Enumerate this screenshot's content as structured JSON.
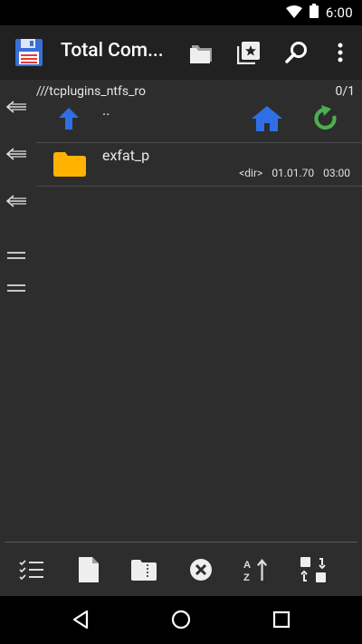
{
  "status": {
    "time": "6:00"
  },
  "app": {
    "title": "Total Com..."
  },
  "panel": {
    "path": "///tcplugins_ntfs_ro",
    "count": "0/1",
    "up_label": "..",
    "files": [
      {
        "name": "exfat_p",
        "type": "<dir>",
        "date": "01.01.70",
        "time": "03:00"
      }
    ]
  },
  "colors": {
    "accent_blue": "#2f6fe6",
    "refresh_green": "#4caf50",
    "folder_yellow": "#ffb300",
    "save_red": "#e53935"
  },
  "icons": {
    "app": "floppy-disk-icon",
    "folder_toolbar": "folders-icon",
    "bookmarks": "star-bookmark-icon",
    "search": "search-icon",
    "more": "more-vert-icon"
  }
}
